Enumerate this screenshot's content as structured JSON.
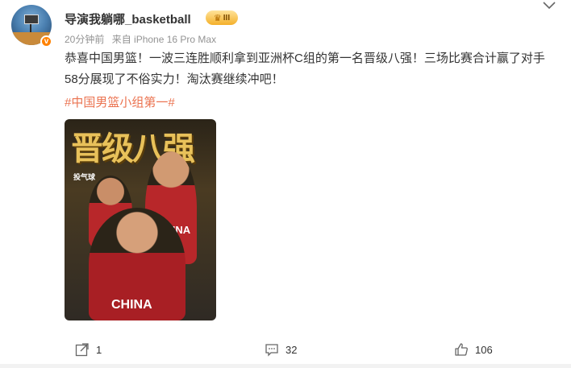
{
  "post": {
    "username": "导演我躺哪_basketball",
    "badge_label": "III",
    "time": "20分钟前",
    "source": "来自 iPhone 16 Pro Max",
    "text": "恭喜中国男篮！一波三连胜顺利拿到亚洲杯C组的第一名晋级八强！三场比赛合计赢了对手58分展现了不俗实力！淘汰赛继续冲吧！",
    "hashtag": "#中国男篮小组第一#",
    "image": {
      "title": "晋级八强",
      "logo": "投气球",
      "jersey_1": "CHINA",
      "jersey_2": "CHINA"
    }
  },
  "actions": {
    "share_count": "1",
    "comment_count": "32",
    "like_count": "106"
  },
  "icons": {
    "verified": "verified-badge-icon",
    "more": "chevron-down-icon",
    "share": "share-icon",
    "comment": "comment-icon",
    "like": "like-icon"
  },
  "colors": {
    "hashtag": "#eb7350",
    "verified": "#ff8200",
    "meta": "#939393"
  }
}
